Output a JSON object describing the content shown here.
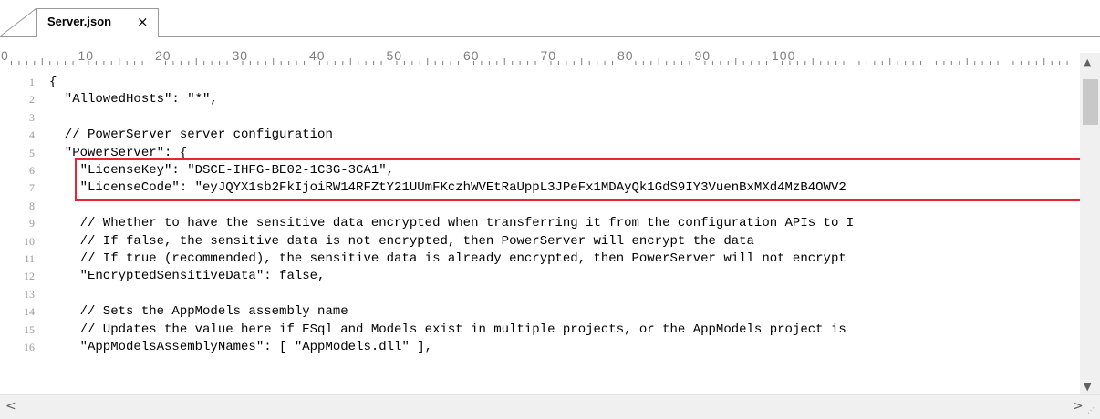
{
  "tab": {
    "filename": "Server.json",
    "close_glyph": "×"
  },
  "ruler": {
    "labels": [
      "0",
      "10",
      "20",
      "30",
      "40",
      "50",
      "60",
      "70",
      "80",
      "90",
      "100"
    ]
  },
  "editor": {
    "lines": [
      {
        "n": "1",
        "text": "{"
      },
      {
        "n": "2",
        "text": "  \"AllowedHosts\": \"*\","
      },
      {
        "n": "3",
        "text": ""
      },
      {
        "n": "4",
        "text": "  // PowerServer server configuration"
      },
      {
        "n": "5",
        "text": "  \"PowerServer\": {"
      },
      {
        "n": "6",
        "text": "    \"LicenseKey\": \"DSCE-IHFG-BE02-1C3G-3CA1\","
      },
      {
        "n": "7",
        "text": "    \"LicenseCode\": \"eyJQYX1sb2FkIjoiRW14RFZtY21UUmFKczhWVEtRaUppL3JPeFx1MDAyQk1GdS9IY3VuenBxMXd4MzB4OWV2"
      },
      {
        "n": "8",
        "text": ""
      },
      {
        "n": "9",
        "text": "    // Whether to have the sensitive data encrypted when transferring it from the configuration APIs to I"
      },
      {
        "n": "10",
        "text": "    // If false, the sensitive data is not encrypted, then PowerServer will encrypt the data"
      },
      {
        "n": "11",
        "text": "    // If true (recommended), the sensitive data is already encrypted, then PowerServer will not encrypt"
      },
      {
        "n": "12",
        "text": "    \"EncryptedSensitiveData\": false,"
      },
      {
        "n": "13",
        "text": ""
      },
      {
        "n": "14",
        "text": "    // Sets the AppModels assembly name"
      },
      {
        "n": "15",
        "text": "    // Updates the value here if ESql and Models exist in multiple projects, or the AppModels project is"
      },
      {
        "n": "16",
        "text": "    \"AppModelsAssemblyNames\": [ \"AppModels.dll\" ],"
      }
    ]
  },
  "colors": {
    "highlight_border": "#e8262d",
    "line_number": "#9a9a9a",
    "ruler": "#7e7e7e"
  },
  "icons": {
    "scroll_up": "▲",
    "scroll_down": "▼",
    "scroll_left": "<",
    "scroll_right": ">",
    "resize_grip": "⋰"
  }
}
